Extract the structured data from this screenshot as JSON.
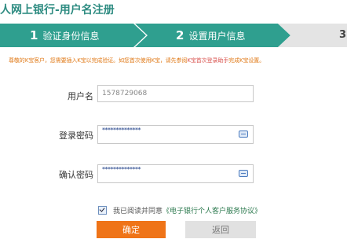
{
  "header": {
    "title": "人网上银行-用户名注册"
  },
  "steps": [
    {
      "num": "1",
      "label": "验证身份信息"
    },
    {
      "num": "2",
      "label": "设置用户信息"
    },
    {
      "num": "3",
      "label": ""
    }
  ],
  "notice": {
    "text_a": "尊敬的K宝客户，您需要插入K宝以完成验证。如您首次使用K宝，请先参阅",
    "link": "K宝首次登录助手",
    "text_b": "完成K宝设置。"
  },
  "form": {
    "username_label": "用户名",
    "username_value": "1578729068",
    "password_label": "登录密码",
    "password_value": "**************",
    "confirm_label": "确认密码",
    "confirm_value": "**************"
  },
  "agreement": {
    "text": "我已阅读并同意",
    "link": "《电子银行个人客户服务协议》",
    "checked": true
  },
  "buttons": {
    "confirm": "确定",
    "back": "返回"
  },
  "colors": {
    "accent": "#2f9f8f",
    "primary_button": "#ef7418",
    "title": "#2f8c82"
  },
  "icons": {
    "keyboard": "keyboard-icon",
    "checkbox": "checkbox-icon"
  }
}
